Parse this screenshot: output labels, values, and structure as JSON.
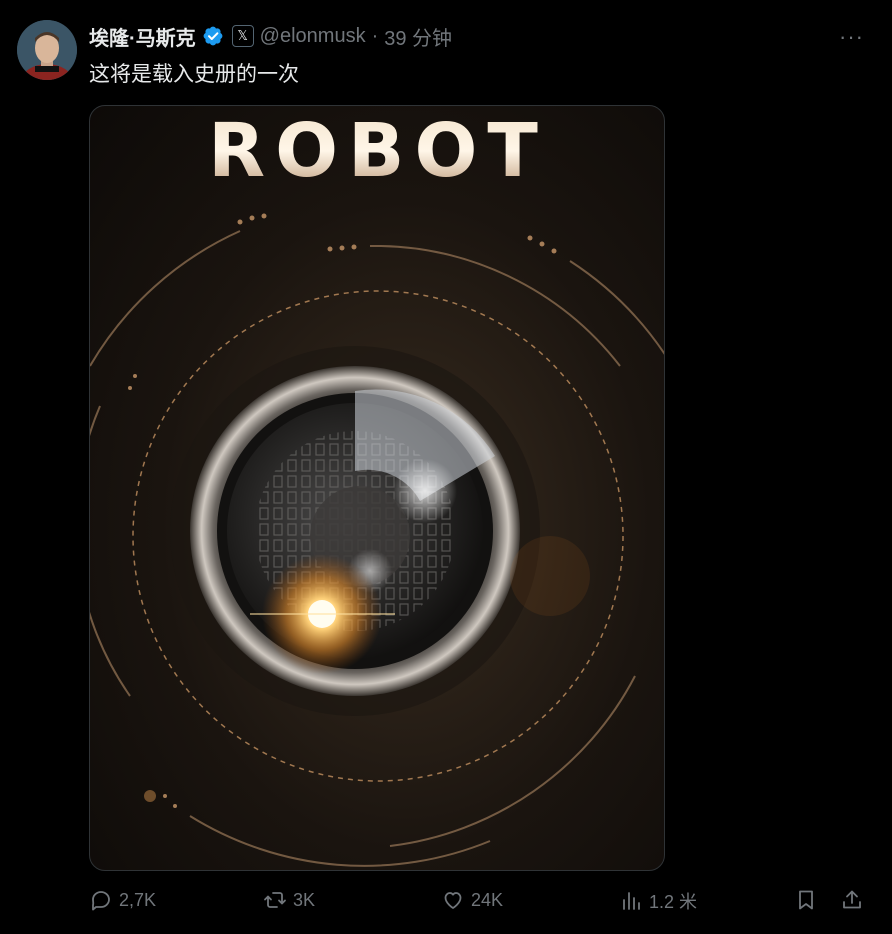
{
  "author": {
    "display_name": "埃隆·马斯克",
    "handle": "@elonmusk",
    "separator": "·",
    "time": "39 分钟",
    "verified_icon": "verified-badge-icon",
    "affiliation_icon": "x-logo-icon",
    "affiliation_glyph": "𝕏"
  },
  "tweet": {
    "text": "这将是载入史册的一次",
    "more_glyph": "···"
  },
  "media": {
    "title": "ROBOT",
    "matrix_digits": "0101 1011 0010 1101 0110 1001 0011 1100"
  },
  "actions": {
    "reply_count": "2,7K",
    "retweet_count": "3K",
    "like_count": "24K",
    "views_count": "1.2 米"
  },
  "colors": {
    "background": "#000000",
    "text_primary": "#e7e9ea",
    "text_secondary": "#71767b",
    "verified_blue": "#1d9bf0",
    "accent_gold": "#d9a56a"
  }
}
